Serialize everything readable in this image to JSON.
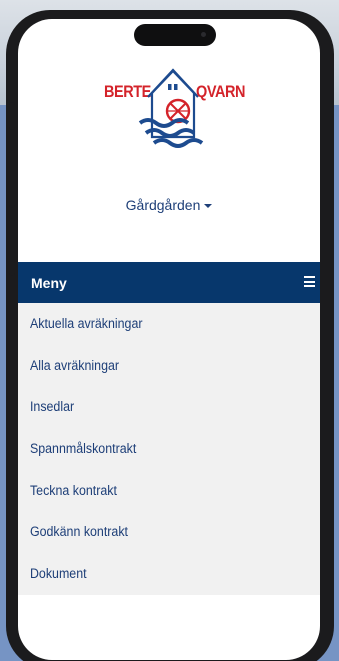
{
  "logo": {
    "left_text": "BERTE",
    "right_text": "QVARN",
    "color": "#d4232a",
    "wave_color": "#1d4b8f"
  },
  "farm_selector": {
    "label": "Gårdgården"
  },
  "menu": {
    "title": "Meny",
    "items": [
      {
        "label": "Aktuella avräkningar"
      },
      {
        "label": "Alla avräkningar"
      },
      {
        "label": "Insedlar"
      },
      {
        "label": "Spannmålskontrakt"
      },
      {
        "label": "Teckna kontrakt"
      },
      {
        "label": "Godkänn kontrakt"
      },
      {
        "label": "Dokument"
      }
    ]
  },
  "colors": {
    "menu_bar": "#07376c",
    "link_text": "#1e3f78",
    "list_bg": "#f1f1f1"
  }
}
